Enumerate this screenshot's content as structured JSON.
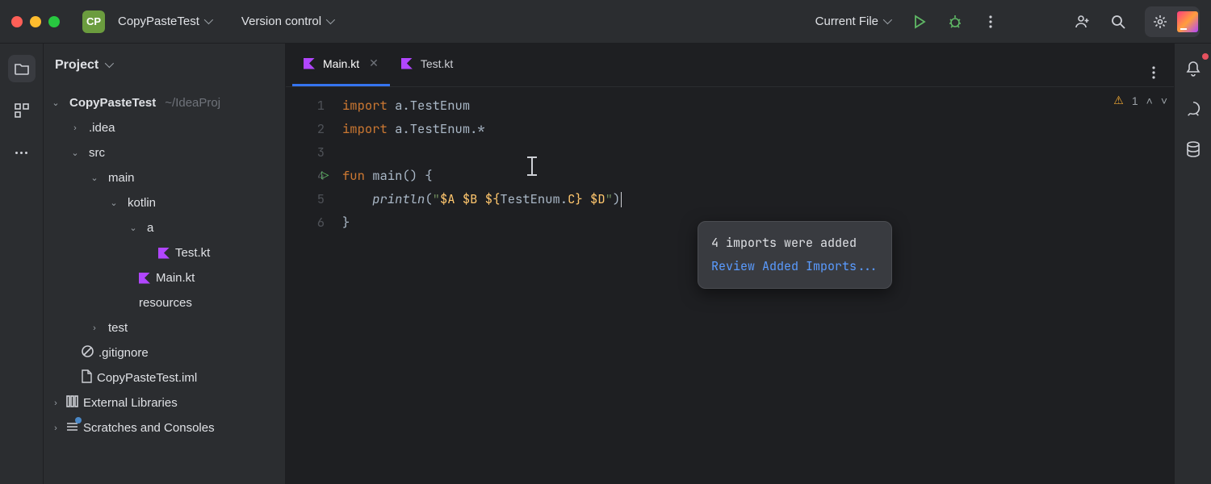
{
  "titlebar": {
    "project_badge": "CP",
    "project_name": "CopyPasteTest",
    "vcs_label": "Version control",
    "run_config": "Current File"
  },
  "project_panel": {
    "header": "Project",
    "root_name": "CopyPasteTest",
    "root_path": "~/IdeaProj",
    "tree": {
      "idea": ".idea",
      "src": "src",
      "main": "main",
      "kotlin": "kotlin",
      "pkg_a": "a",
      "test_kt": "Test.kt",
      "main_kt": "Main.kt",
      "resources": "resources",
      "test_dir": "test",
      "gitignore": ".gitignore",
      "iml": "CopyPasteTest.iml",
      "ext_libs": "External Libraries",
      "scratches": "Scratches and Consoles"
    }
  },
  "tabs": [
    {
      "label": "Main.kt",
      "active": true
    },
    {
      "label": "Test.kt",
      "active": false
    }
  ],
  "editor": {
    "lines": [
      "1",
      "2",
      "3",
      "4",
      "5",
      "6"
    ],
    "code": {
      "l1_a": "import",
      "l1_b": " a.TestEnum",
      "l2_a": "import",
      "l2_b": " a.TestEnum.*",
      "l4_a": "fun",
      "l4_b": " main() {",
      "l5_a": "    println",
      "l5_b": "(",
      "l5_c": "\"",
      "l5_d": "$A",
      "l5_e": " ",
      "l5_f": "$B",
      "l5_g": " ",
      "l5_h": "${",
      "l5_i": "TestEnum.",
      "l5_j": "C",
      "l5_k": "}",
      "l5_l": " ",
      "l5_m": "$D",
      "l5_n": "\"",
      "l5_o": ")",
      "l6": "}"
    }
  },
  "inspection": {
    "warnings": "1"
  },
  "popup": {
    "text": "4 imports were added",
    "link": "Review Added Imports..."
  }
}
